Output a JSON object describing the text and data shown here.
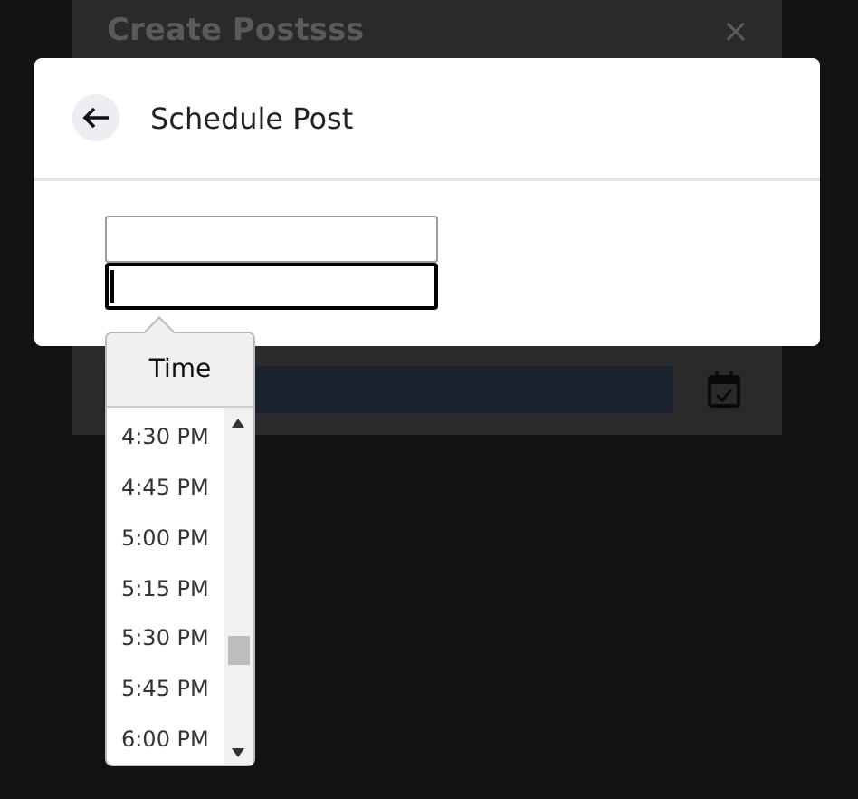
{
  "background_modal": {
    "title": "Create Postsss",
    "close": "×"
  },
  "dialog": {
    "title": "Schedule Post",
    "fields": [
      {
        "focused": false
      },
      {
        "focused": true
      }
    ]
  },
  "time_picker": {
    "header": "Time",
    "options": [
      "4:30 PM",
      "4:45 PM",
      "5:00 PM",
      "5:15 PM",
      "5:30 PM",
      "5:45 PM",
      "6:00 PM"
    ]
  }
}
